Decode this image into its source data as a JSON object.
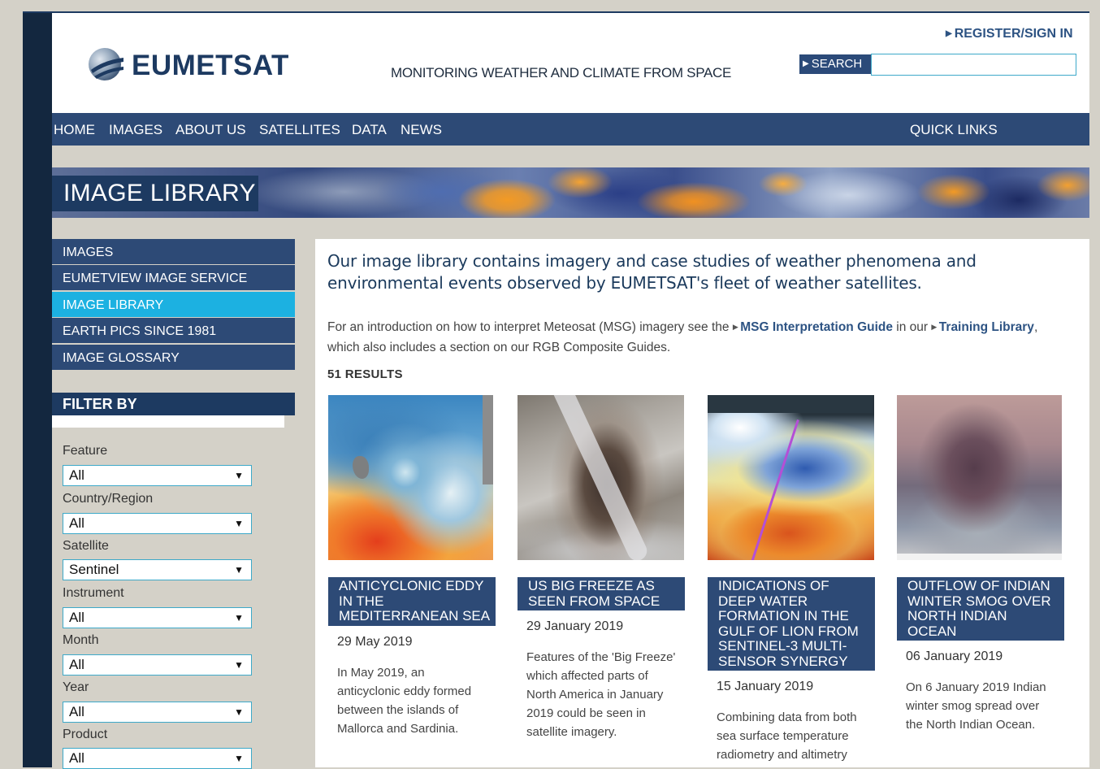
{
  "header": {
    "logo_text": "EUMETSAT",
    "tagline": "MONITORING WEATHER AND CLIMATE FROM SPACE",
    "register_label": "REGISTER/SIGN IN",
    "search_label": "SEARCH",
    "search_value": ""
  },
  "nav": {
    "items": [
      "HOME",
      "IMAGES",
      "ABOUT US",
      "SATELLITES",
      "DATA",
      "NEWS"
    ],
    "quick_links": "QUICK LINKS"
  },
  "banner": {
    "title": "IMAGE LIBRARY"
  },
  "sidebar": {
    "items": [
      {
        "label": "IMAGES",
        "active": false
      },
      {
        "label": "EUMETVIEW IMAGE SERVICE",
        "active": false
      },
      {
        "label": "IMAGE LIBRARY",
        "active": true
      },
      {
        "label": "EARTH PICS SINCE 1981",
        "active": false
      },
      {
        "label": "IMAGE GLOSSARY",
        "active": false
      }
    ],
    "filter_title": "FILTER BY",
    "filters": [
      {
        "label": "Feature",
        "value": "All"
      },
      {
        "label": "Country/Region",
        "value": "All"
      },
      {
        "label": "Satellite",
        "value": "Sentinel"
      },
      {
        "label": "Instrument",
        "value": "All"
      },
      {
        "label": "Month",
        "value": "All"
      },
      {
        "label": "Year",
        "value": "All"
      },
      {
        "label": "Product",
        "value": "All"
      }
    ]
  },
  "main": {
    "intro": "Our image library contains imagery and case studies of weather phenomena and environmental events observed by EUMETSAT's fleet of weather satellites.",
    "desc_before": "For an introduction on how to interpret Meteosat (MSG) imagery see the ",
    "link1": "MSG Interpretation Guide",
    "desc_middle": " in our ",
    "link2": "Training Library",
    "desc_after": ", which also includes a section on our RGB Composite Guides.",
    "results": "51 RESULTS",
    "cards": [
      {
        "title": "ANTICYCLONIC EDDY IN THE MEDITERRANEAN SEA",
        "date": "29 May 2019",
        "text": "In May 2019, an anticyclonic eddy formed between the islands of Mallorca and Sardinia."
      },
      {
        "title": "US BIG FREEZE AS SEEN FROM SPACE",
        "date": "29 January 2019",
        "text": "Features of the 'Big Freeze' which affected parts of North America in January 2019 could be seen in satellite imagery."
      },
      {
        "title": "INDICATIONS OF DEEP WATER FORMATION IN THE GULF OF LION FROM SENTINEL-3 MULTI-SENSOR SYNERGY",
        "date": "15 January 2019",
        "text": "Combining data from both sea surface temperature radiometry and altimetry"
      },
      {
        "title": "OUTFLOW OF INDIAN WINTER SMOG OVER NORTH INDIAN OCEAN",
        "date": "06 January 2019",
        "text": "On 6 January 2019 Indian winter smog spread over the North Indian Ocean."
      }
    ]
  },
  "colors": {
    "brand_navy": "#1d3a61",
    "nav_blue": "#2d4a76",
    "active_cyan": "#1cb1e1",
    "link_blue": "#2d5383"
  }
}
